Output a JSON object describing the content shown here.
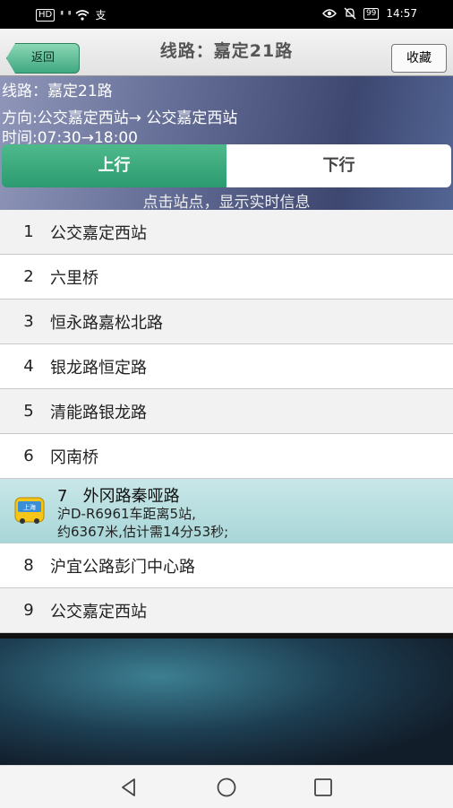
{
  "status_bar": {
    "left_icons": [
      "HD",
      "⁴ᴳ",
      "⁴ᴳ",
      "wifi",
      "支"
    ],
    "right_icons": [
      "eye-icon",
      "mute-icon"
    ],
    "battery": "99",
    "time": "14:57"
  },
  "header": {
    "back_label": "返回",
    "title": "线路：嘉定21路",
    "favorite_label": "收藏"
  },
  "info": {
    "route": "线路：嘉定21路",
    "direction": "方向:公交嘉定西站→ 公交嘉定西站",
    "time": "时间:07:30→18:00",
    "tabs": [
      {
        "label": "上行",
        "active": true
      },
      {
        "label": "下行",
        "active": false
      }
    ],
    "hint": "点击站点，显示实时信息"
  },
  "stations": [
    {
      "num": "1",
      "name": "公交嘉定西站"
    },
    {
      "num": "2",
      "name": "六里桥"
    },
    {
      "num": "3",
      "name": "恒永路嘉松北路"
    },
    {
      "num": "4",
      "name": "银龙路恒定路"
    },
    {
      "num": "5",
      "name": "清能路银龙路"
    },
    {
      "num": "6",
      "name": "冈南桥"
    },
    {
      "num": "7",
      "name": "外冈路秦哑路",
      "bus_label": "上海",
      "realtime_line1": "沪D-R6961车距离5站,",
      "realtime_line2": "约6367米,估计需14分53秒;"
    },
    {
      "num": "8",
      "name": "沪宜公路彭门中心路"
    },
    {
      "num": "9",
      "name": "公交嘉定西站"
    }
  ],
  "colors": {
    "accent_green": "#3fa882",
    "highlight_row": "#b8dedf"
  },
  "nav": [
    "back-triangle-icon",
    "home-circle-icon",
    "recents-square-icon"
  ]
}
